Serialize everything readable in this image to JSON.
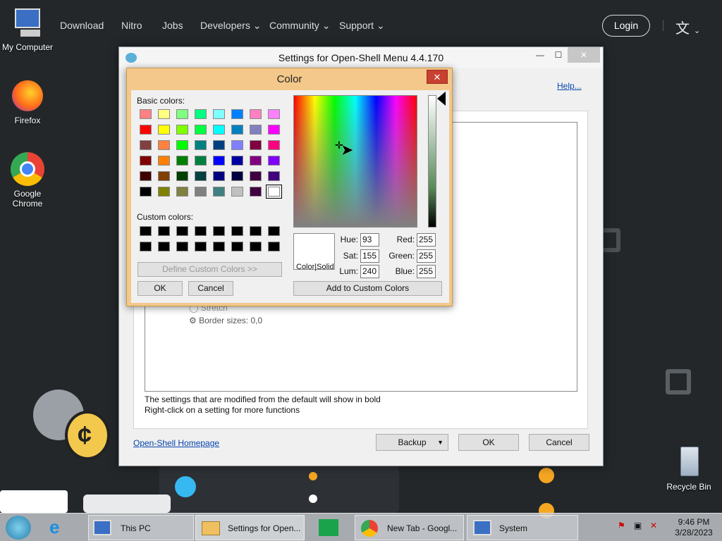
{
  "web": {
    "nav": [
      "Download",
      "Nitro",
      "Jobs",
      "Developers",
      "Community",
      "Support"
    ],
    "login": "Login"
  },
  "desktop": {
    "icons": [
      "My Computer",
      "Firefox",
      "Google Chrome",
      "Recycle Bin"
    ]
  },
  "settings": {
    "title": "Settings for Open-Shell Menu 4.4.170",
    "help": "Help...",
    "stretch": "Stretch",
    "border": "Border sizes: 0,0",
    "note1": "The settings that are modified from the default will show in bold",
    "note2": "Right-click on a setting for more functions",
    "homepage": "Open-Shell Homepage",
    "backup": "Backup",
    "ok": "OK",
    "cancel": "Cancel"
  },
  "color_dialog": {
    "title": "Color",
    "basic_label": "Basic colors:",
    "custom_label": "Custom colors:",
    "define": "Define Custom Colors >>",
    "ok": "OK",
    "cancel": "Cancel",
    "add": "Add to Custom Colors",
    "color_solid": "Color|Solid",
    "hue_label": "Hue:",
    "hue": "93",
    "sat_label": "Sat:",
    "sat": "155",
    "lum_label": "Lum:",
    "lum": "240",
    "red_label": "Red:",
    "red": "255",
    "green_label": "Green:",
    "green": "255",
    "blue_label": "Blue:",
    "blue": "255",
    "basic_colors": [
      "#ff8080",
      "#ffff80",
      "#80ff80",
      "#00ff80",
      "#80ffff",
      "#0080ff",
      "#ff80c0",
      "#ff80ff",
      "#ff0000",
      "#ffff00",
      "#80ff00",
      "#00ff40",
      "#00ffff",
      "#0080c0",
      "#8080c0",
      "#ff00ff",
      "#804040",
      "#ff8040",
      "#00ff00",
      "#008080",
      "#004080",
      "#8080ff",
      "#800040",
      "#ff0080",
      "#800000",
      "#ff8000",
      "#008000",
      "#008040",
      "#0000ff",
      "#0000a0",
      "#800080",
      "#8000ff",
      "#400000",
      "#804000",
      "#004000",
      "#004040",
      "#000080",
      "#000040",
      "#400040",
      "#400080",
      "#000000",
      "#808000",
      "#808040",
      "#808080",
      "#408080",
      "#c0c0c0",
      "#400040",
      "#ffffff"
    ],
    "custom_colors": [
      "#000000",
      "#000000",
      "#000000",
      "#000000",
      "#000000",
      "#000000",
      "#000000",
      "#000000",
      "#000000",
      "#000000",
      "#000000",
      "#000000",
      "#000000",
      "#000000",
      "#000000",
      "#000000"
    ]
  },
  "taskbar": {
    "tasks": [
      "This PC",
      "Settings for Open...",
      "New Tab - Googl...",
      "System"
    ],
    "time": "9:46 PM",
    "date": "3/28/2023"
  }
}
